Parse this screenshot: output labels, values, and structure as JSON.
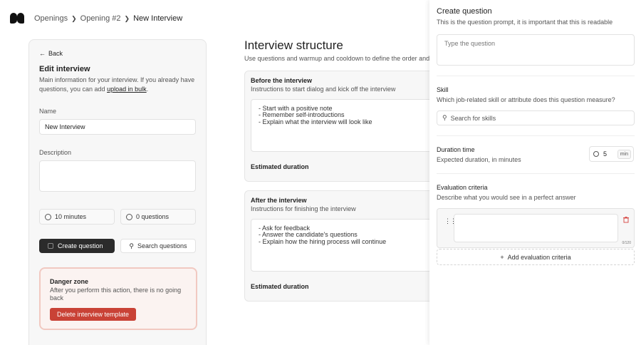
{
  "breadcrumb": {
    "items": [
      "Openings",
      "Opening #2",
      "New Interview"
    ]
  },
  "left": {
    "back_label": "Back",
    "title": "Edit interview",
    "description_pre": "Main information for your interview. If you already have questions, you can add",
    "upload_link": "upload in bulk",
    "description_post": ".",
    "name_label": "Name",
    "name_value": "New Interview",
    "description_label": "Description",
    "description_value": "",
    "duration_stat": "10 minutes",
    "questions_stat": "0 questions",
    "create_question": "Create question",
    "search_questions": "Search questions",
    "danger_title": "Danger zone",
    "danger_text": "After you perform this action, there is no going back",
    "delete_label": "Delete interview template"
  },
  "structure": {
    "title": "Interview structure",
    "subtitle": "Use questions and warmup and cooldown to define the order and"
  },
  "before": {
    "title": "Before the interview",
    "subtitle": "Instructions to start dialog and kick off the interview",
    "text": "- Start with a positive note\n- Remember self-introductions\n- Explain what the interview will look like",
    "estimated": "Estimated duration"
  },
  "after": {
    "title": "After the interview",
    "subtitle": "Instructions for finishing the interview",
    "text": "- Ask for feedback\n- Answer the candidate's questions\n- Explain how the hiring process will continue",
    "estimated": "Estimated duration"
  },
  "drawer": {
    "title": "Create question",
    "subtitle": "This is the question prompt, it is important that this is readable",
    "question_placeholder": "Type the question",
    "skill_title": "Skill",
    "skill_subtitle": "Which job-related skill or attribute does this question measure?",
    "skill_placeholder": "Search for skills",
    "duration_title": "Duration time",
    "duration_subtitle": "Expected duration, in minutes",
    "duration_value": "5",
    "duration_unit": "min",
    "criteria_title": "Evaluation criteria",
    "criteria_subtitle": "Describe what you would see in a perfect answer",
    "criteria_counter": "0/120",
    "add_criteria": "Add evaluation criteria"
  },
  "colors": {
    "danger_button": "#c94236",
    "primary_button": "#2b2b2b",
    "trash_icon": "#d9534f"
  }
}
